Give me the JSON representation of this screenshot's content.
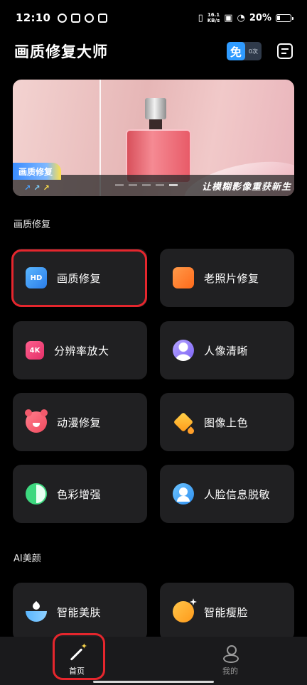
{
  "status_bar": {
    "time": "12:10",
    "net_speed_value": "16.1",
    "net_speed_unit": "KB/s",
    "battery": "20%"
  },
  "header": {
    "title": "画质修复大师",
    "free_badge_icon_text": "免",
    "free_badge_count": "0次"
  },
  "banner": {
    "tag": "画质修复",
    "slogan": "让模糊影像重获新生",
    "arrows": [
      "↗",
      "↗",
      "↗"
    ],
    "arrow_colors": [
      "#4aa3ff",
      "#7fd0ff",
      "#ffe14a"
    ]
  },
  "sections": {
    "quality_title": "画质修复",
    "beauty_title": "AI美颜"
  },
  "cards": {
    "quality_repair": {
      "label": "画质修复",
      "icon": "hd-icon",
      "icon_text": "HD"
    },
    "old_photo": {
      "label": "老照片修复",
      "icon": "photo-icon"
    },
    "upscale": {
      "label": "分辨率放大",
      "icon": "4k-icon",
      "icon_text": "4K"
    },
    "portrait_clear": {
      "label": "人像清晰",
      "icon": "portrait-icon"
    },
    "anime_repair": {
      "label": "动漫修复",
      "icon": "bear-icon"
    },
    "colorize": {
      "label": "图像上色",
      "icon": "paint-bucket-icon"
    },
    "color_enhance": {
      "label": "色彩增强",
      "icon": "contrast-icon"
    },
    "face_desensitize": {
      "label": "人脸信息脱敏",
      "icon": "face-icon"
    },
    "smart_skin": {
      "label": "智能美肤",
      "icon": "skin-icon"
    },
    "smart_slim": {
      "label": "智能瘦脸",
      "icon": "slim-face-icon"
    }
  },
  "bottom_nav": {
    "home": "首页",
    "me": "我的"
  },
  "colors": {
    "background": "#000000",
    "card": "#202022",
    "highlight": "#e5262d",
    "accent_blue": "#2f9bff"
  }
}
